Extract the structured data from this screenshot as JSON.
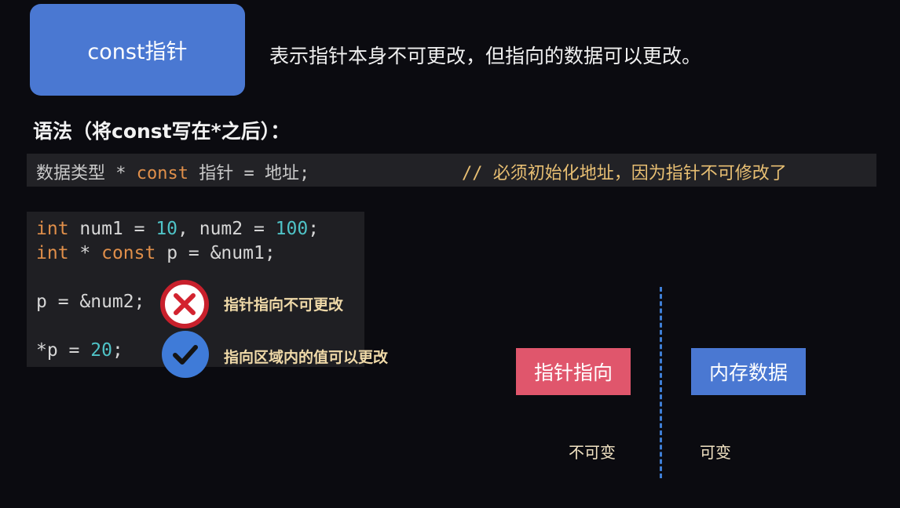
{
  "header": {
    "badge": "const指针",
    "intro": "表示指针本身不可更改，但指向的数据可以更改。"
  },
  "syntax": {
    "heading": "语法（将const写在*之后）：",
    "line_prefix": "数据类型 * ",
    "line_kw": "const",
    "line_suffix": " 指针 = 地址;",
    "comment": "// 必须初始化地址，因为指针不可修改了"
  },
  "code": {
    "line1": {
      "kw": "int",
      "a": " num1 = ",
      "n1": "10",
      "b": ", num2 = ",
      "n2": "100",
      "c": ";"
    },
    "line2": {
      "kw1": "int",
      "a": " * ",
      "kw2": "const",
      "b": " p = &num1;"
    },
    "line3": {
      "text": "p = &num2;"
    },
    "line4": {
      "a": "*p = ",
      "n": "20",
      "b": ";"
    }
  },
  "notes": {
    "invalid": "指针指向不可更改",
    "valid": "指向区域内的值可以更改"
  },
  "icons": {
    "invalid": "x-circle-icon",
    "valid": "check-circle-icon"
  },
  "diagram": {
    "left_box": "指针指向",
    "right_box": "内存数据",
    "left_label": "不可变",
    "right_label": "可变"
  },
  "colors": {
    "accent_blue": "#4a78d2",
    "accent_red": "#e0566c",
    "keyword": "#e08f4a",
    "number": "#4fc3c7",
    "comment": "#e8bf73"
  }
}
